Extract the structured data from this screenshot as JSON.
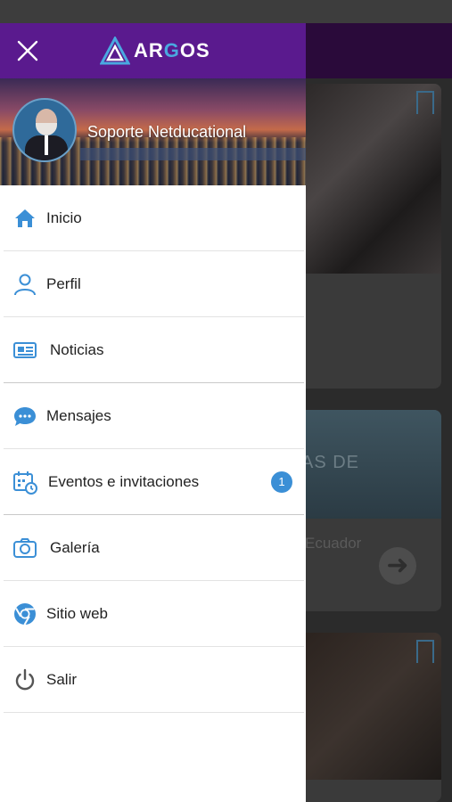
{
  "app": {
    "brand_prefix": "AR",
    "brand_accent": "G",
    "brand_suffix": "OS",
    "brand_color": "#5a1a8e",
    "accent_color": "#3b8fd6"
  },
  "profile": {
    "name": "Soporte Netducational"
  },
  "menu": {
    "items": [
      {
        "label": "Inicio",
        "icon": "home-icon"
      },
      {
        "label": "Perfil",
        "icon": "user-icon"
      },
      {
        "label": "Noticias",
        "icon": "newspaper-icon"
      },
      {
        "label": "Mensajes",
        "icon": "chat-bubble-icon"
      },
      {
        "label": "Eventos e invitaciones",
        "icon": "calendar-clock-icon",
        "badge": "1"
      },
      {
        "label": "Galería",
        "icon": "camera-icon"
      },
      {
        "label": "Sitio web",
        "icon": "chrome-icon"
      },
      {
        "label": "Salir",
        "icon": "power-icon"
      }
    ]
  },
  "background": {
    "card2_overlay": "AS DE",
    "card2_caption": "Ecuador"
  }
}
